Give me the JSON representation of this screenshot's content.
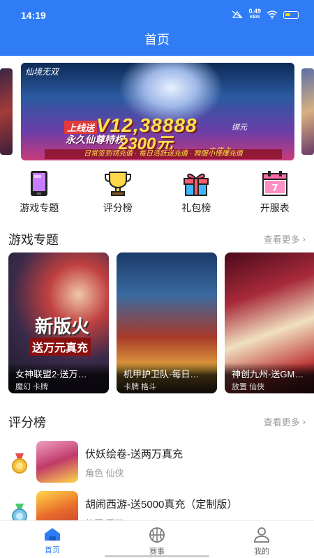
{
  "status": {
    "time": "14:19",
    "net_speed": "0.49",
    "net_unit": "KB/S"
  },
  "header": {
    "title": "首页"
  },
  "banner": {
    "logo": "仙境无双",
    "line1": "上线送",
    "vip": "V12,38888",
    "vip_suffix": "绑元",
    "line2": "永久仙尊特权",
    "amount": "2300元",
    "amount_suffix": "充值卡",
    "strip": "日常签到领充值 · 每日活跃送充值 · 跨服小怪爆充值"
  },
  "quicknav": [
    {
      "label": "游戏专题",
      "icon": "phone-icon"
    },
    {
      "label": "评分榜",
      "icon": "trophy-icon"
    },
    {
      "label": "礼包榜",
      "icon": "gift-icon"
    },
    {
      "label": "开服表",
      "icon": "calendar-icon"
    }
  ],
  "topics": {
    "title": "游戏专题",
    "more": "查看更多",
    "cards": [
      {
        "name": "女神联盟2-送万…",
        "tags": "魔幻 卡牌",
        "promo": "新版火",
        "promo2": "送万元真充"
      },
      {
        "name": "机甲护卫队-每日…",
        "tags": "卡牌 格斗",
        "promo": "",
        "promo2": ""
      },
      {
        "name": "神创九州-送GM…",
        "tags": "放置 仙侠",
        "promo": "",
        "promo2": ""
      }
    ]
  },
  "ratings": {
    "title": "评分榜",
    "more": "查看更多",
    "items": [
      {
        "name": "伏妖绘卷-送两万真充",
        "tags": "角色 仙侠",
        "medal": "gold"
      },
      {
        "name": "胡闹西游-送5000真充（定制版）",
        "tags": "放置 西游",
        "medal": "silver"
      }
    ]
  },
  "tabbar": [
    {
      "label": "首页",
      "active": true
    },
    {
      "label": "赛事",
      "active": false
    },
    {
      "label": "我的",
      "active": false
    }
  ],
  "colors": {
    "primary": "#2f7cf6",
    "gold": "#f5c542",
    "silver": "#7fc8e8"
  }
}
